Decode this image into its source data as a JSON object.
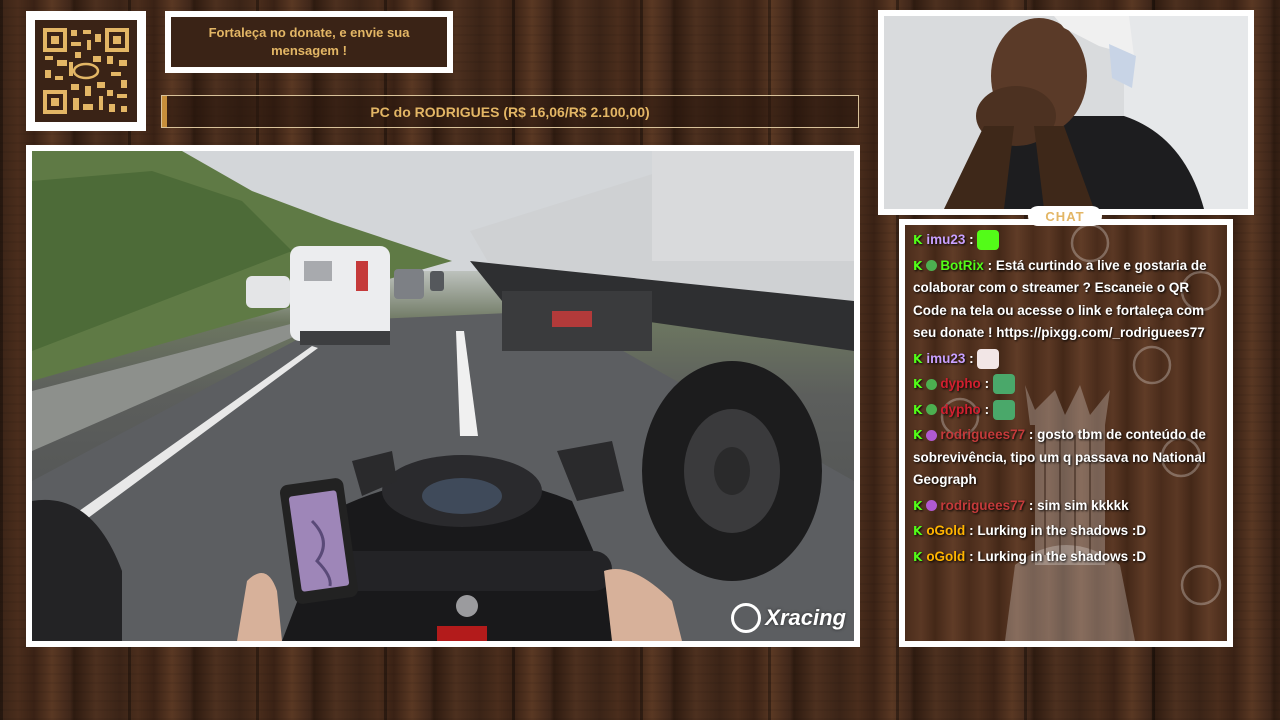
{
  "donate_message": "Fortaleça no donate, e envie sua mensagem !",
  "goal": {
    "label": "PC do RODRIGUES (R$ 16,06/R$ 2.100,00)",
    "progress": 0.0076
  },
  "video": {
    "watermark": "Xracing"
  },
  "chat": {
    "title": "CHAT",
    "messages": [
      {
        "user": "imu23",
        "sep": ":",
        "text": "",
        "user_color": "#c9a0ff",
        "emote": "kick-k"
      },
      {
        "user": "BotRix",
        "sep": ":",
        "text": "Está curtindo a live e gostaria de colaborar com o streamer ? Escaneie o QR Code na tela ou acesse o link e fortaleça com seu donate ! https://pixgg.com/_rodriguees77",
        "user_color": "#53fc18"
      },
      {
        "user": "imu23",
        "sep": ":",
        "text": "",
        "user_color": "#c9a0ff",
        "emote": "cat"
      },
      {
        "user": "dypho",
        "sep": ":",
        "text": "",
        "user_color": "#d11f2f",
        "emote": "frog"
      },
      {
        "user": "dypho",
        "sep": ":",
        "text": "",
        "user_color": "#d11f2f",
        "emote": "frog"
      },
      {
        "user": "rodriguees77",
        "sep": ":",
        "text": "gosto tbm de conteúdo de sobrevivência, tipo um q passava no National Geograph",
        "user_color": "#c43a3a"
      },
      {
        "user": "rodriguees77",
        "sep": ":",
        "text": "sim sim kkkkk",
        "user_color": "#c43a3a"
      },
      {
        "user": "oGold",
        "sep": ":",
        "text": "Lurking in the shadows :D",
        "user_color": "#ffb400"
      },
      {
        "user": "oGold",
        "sep": ":",
        "text": "Lurking in the shadows :D",
        "user_color": "#ffb400"
      }
    ]
  },
  "colors": {
    "accent_gold": "#e3b665",
    "kick_green": "#53fc18",
    "wood_dark": "#3a2316"
  }
}
